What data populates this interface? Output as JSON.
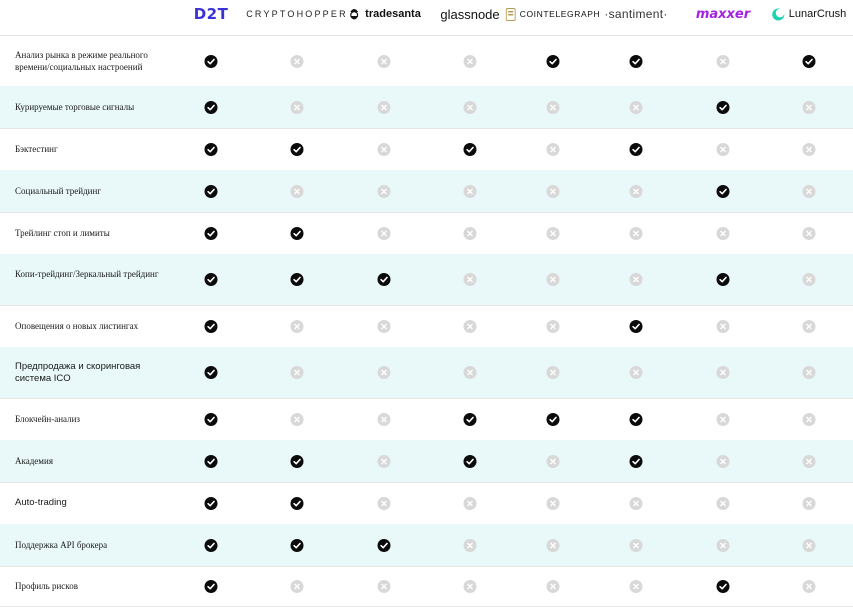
{
  "columns": [
    {
      "id": "d2t",
      "label": "D2T"
    },
    {
      "id": "cryptohopper",
      "label": "CRYPTOHOPPER"
    },
    {
      "id": "tradesanta",
      "label": "tradesanta"
    },
    {
      "id": "glassnode",
      "label": "glassnode"
    },
    {
      "id": "cointelegraph",
      "label": "COINTELEGRAPH"
    },
    {
      "id": "santiment",
      "label": "·santiment·"
    },
    {
      "id": "maxxer",
      "label": "maxxer"
    },
    {
      "id": "lunarcrush",
      "label": "LunarCrush"
    }
  ],
  "colors": {
    "row_alt_bg": "#e9f8f9",
    "check_yes": "#0b0b0b",
    "check_no": "#d8d8d8",
    "d2t_brand": "#3b31d6",
    "maxxer_brand": "#a523e0",
    "lunarcrush_brand": "#19d3b2"
  },
  "rows": [
    {
      "label": "Анализ рынка в режиме реального времени/социальных настроений",
      "values": [
        true,
        false,
        false,
        false,
        true,
        true,
        false,
        true
      ]
    },
    {
      "label": "Курируемые торговые сигналы",
      "values": [
        true,
        false,
        false,
        false,
        false,
        false,
        true,
        false
      ]
    },
    {
      "label": "Бэктестинг",
      "values": [
        true,
        true,
        false,
        true,
        false,
        true,
        false,
        false
      ]
    },
    {
      "label": "Социальный трейдинг",
      "values": [
        true,
        false,
        false,
        false,
        false,
        false,
        true,
        false
      ]
    },
    {
      "label": "Трейлинг стоп и лимиты",
      "values": [
        true,
        true,
        false,
        false,
        false,
        false,
        false,
        false
      ]
    },
    {
      "label": "Копи-трейдинг/Зеркальный трейдинг",
      "values": [
        true,
        true,
        true,
        false,
        false,
        false,
        true,
        false
      ]
    },
    {
      "label": "Оповещения о новых листингах",
      "values": [
        true,
        false,
        false,
        false,
        false,
        true,
        false,
        false
      ]
    },
    {
      "label": "Предпродажа и скоринговая система ICO",
      "values": [
        true,
        false,
        false,
        false,
        false,
        false,
        false,
        false
      ]
    },
    {
      "label": "Блокчейн-анализ",
      "values": [
        true,
        false,
        false,
        true,
        true,
        true,
        false,
        false
      ]
    },
    {
      "label": "Академия",
      "values": [
        true,
        true,
        false,
        true,
        false,
        true,
        false,
        false
      ]
    },
    {
      "label": "Auto-trading",
      "values": [
        true,
        true,
        false,
        false,
        false,
        false,
        false,
        false
      ]
    },
    {
      "label": "Поддержка API брокера",
      "values": [
        true,
        true,
        true,
        false,
        false,
        false,
        false,
        false
      ]
    },
    {
      "label": "Профиль рисков",
      "values": [
        true,
        false,
        false,
        false,
        false,
        false,
        true,
        false
      ]
    }
  ]
}
